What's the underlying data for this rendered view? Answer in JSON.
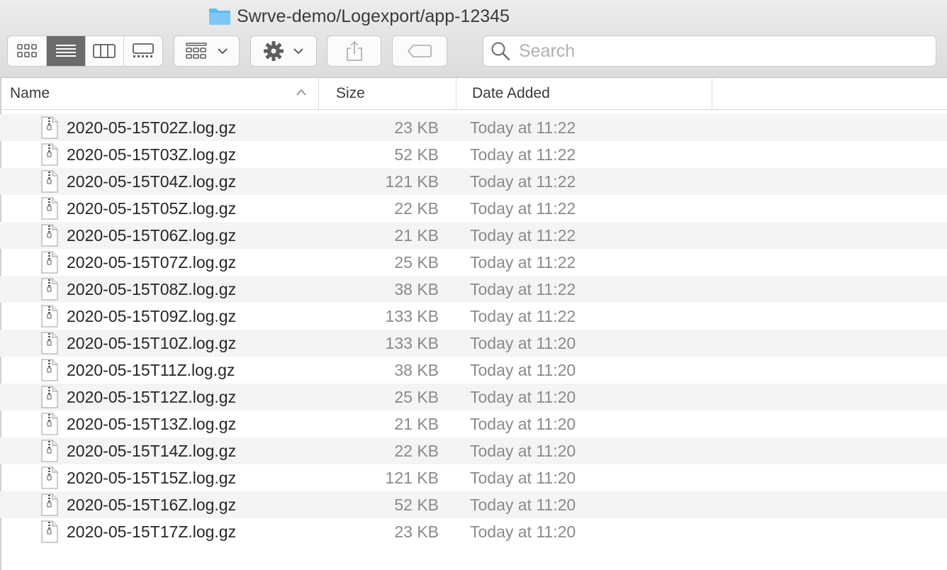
{
  "window": {
    "path_title": "Swrve-demo/Logexport/app-12345",
    "folder_icon": "folder-icon",
    "folder_color": "#5eb8f0"
  },
  "toolbar": {
    "view_modes": [
      {
        "name": "icon-view",
        "icon": "grid-icon",
        "active": false
      },
      {
        "name": "list-view",
        "icon": "list-icon",
        "active": true
      },
      {
        "name": "column-view",
        "icon": "columns-icon",
        "active": false
      },
      {
        "name": "gallery-view",
        "icon": "gallery-icon",
        "active": false
      }
    ],
    "group_icon": "group-grid-icon",
    "action_icon": "gear-icon",
    "share_icon": "share-icon",
    "tag_icon": "tag-icon"
  },
  "search": {
    "placeholder": "Search",
    "value": ""
  },
  "columns": {
    "name": "Name",
    "size": "Size",
    "date": "Date Added",
    "sort": "ascending"
  },
  "files": [
    {
      "name": "2020-05-15T02Z.log.gz",
      "size": "23 KB",
      "date": "Today at 11:22"
    },
    {
      "name": "2020-05-15T03Z.log.gz",
      "size": "52 KB",
      "date": "Today at 11:22"
    },
    {
      "name": "2020-05-15T04Z.log.gz",
      "size": "121 KB",
      "date": "Today at 11:22"
    },
    {
      "name": "2020-05-15T05Z.log.gz",
      "size": "22 KB",
      "date": "Today at 11:22"
    },
    {
      "name": "2020-05-15T06Z.log.gz",
      "size": "21 KB",
      "date": "Today at 11:22"
    },
    {
      "name": "2020-05-15T07Z.log.gz",
      "size": "25 KB",
      "date": "Today at 11:22"
    },
    {
      "name": "2020-05-15T08Z.log.gz",
      "size": "38 KB",
      "date": "Today at 11:22"
    },
    {
      "name": "2020-05-15T09Z.log.gz",
      "size": "133 KB",
      "date": "Today at 11:22"
    },
    {
      "name": "2020-05-15T10Z.log.gz",
      "size": "133 KB",
      "date": "Today at 11:20"
    },
    {
      "name": "2020-05-15T11Z.log.gz",
      "size": "38 KB",
      "date": "Today at 11:20"
    },
    {
      "name": "2020-05-15T12Z.log.gz",
      "size": "25 KB",
      "date": "Today at 11:20"
    },
    {
      "name": "2020-05-15T13Z.log.gz",
      "size": "21 KB",
      "date": "Today at 11:20"
    },
    {
      "name": "2020-05-15T14Z.log.gz",
      "size": "22 KB",
      "date": "Today at 11:20"
    },
    {
      "name": "2020-05-15T15Z.log.gz",
      "size": "121 KB",
      "date": "Today at 11:20"
    },
    {
      "name": "2020-05-15T16Z.log.gz",
      "size": "52 KB",
      "date": "Today at 11:20"
    },
    {
      "name": "2020-05-15T17Z.log.gz",
      "size": "23 KB",
      "date": "Today at 11:20"
    }
  ]
}
